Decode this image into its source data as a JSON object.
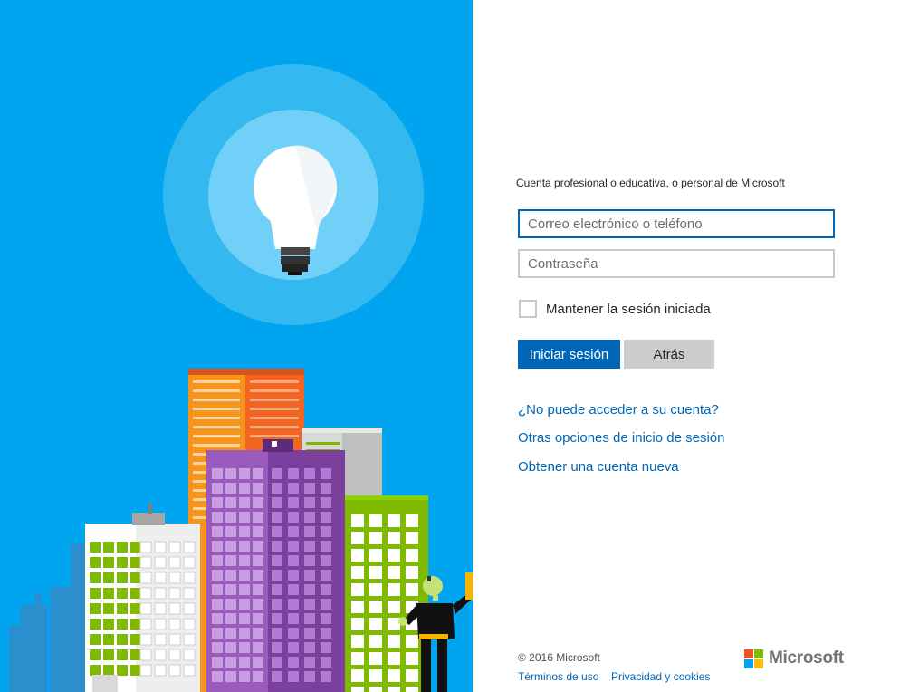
{
  "signin": {
    "heading": "Cuenta profesional o educativa, o personal de Microsoft",
    "email_placeholder": "Correo electrónico o teléfono",
    "password_placeholder": "Contraseña",
    "keep_signed_in_label": "Mantener la sesión iniciada",
    "keep_signed_in_checked": false,
    "signin_button": "Iniciar sesión",
    "back_button": "Atrás"
  },
  "links": {
    "cant_access": "¿No puede acceder a su cuenta?",
    "other_options": "Otras opciones de inicio de sesión",
    "new_account": "Obtener una cuenta nueva"
  },
  "footer": {
    "copyright": "© 2016 Microsoft",
    "terms": "Términos de uso",
    "privacy": "Privacidad y cookies"
  },
  "brand": {
    "name": "Microsoft",
    "colors": {
      "red": "#f25022",
      "green": "#7fba00",
      "blue": "#00a4ef",
      "yellow": "#ffb900",
      "panel": "#00a4ef",
      "accent": "#0067b8"
    }
  },
  "illustration": {
    "icons": [
      "lightbulb-icon",
      "city-buildings",
      "person-with-phone"
    ]
  }
}
